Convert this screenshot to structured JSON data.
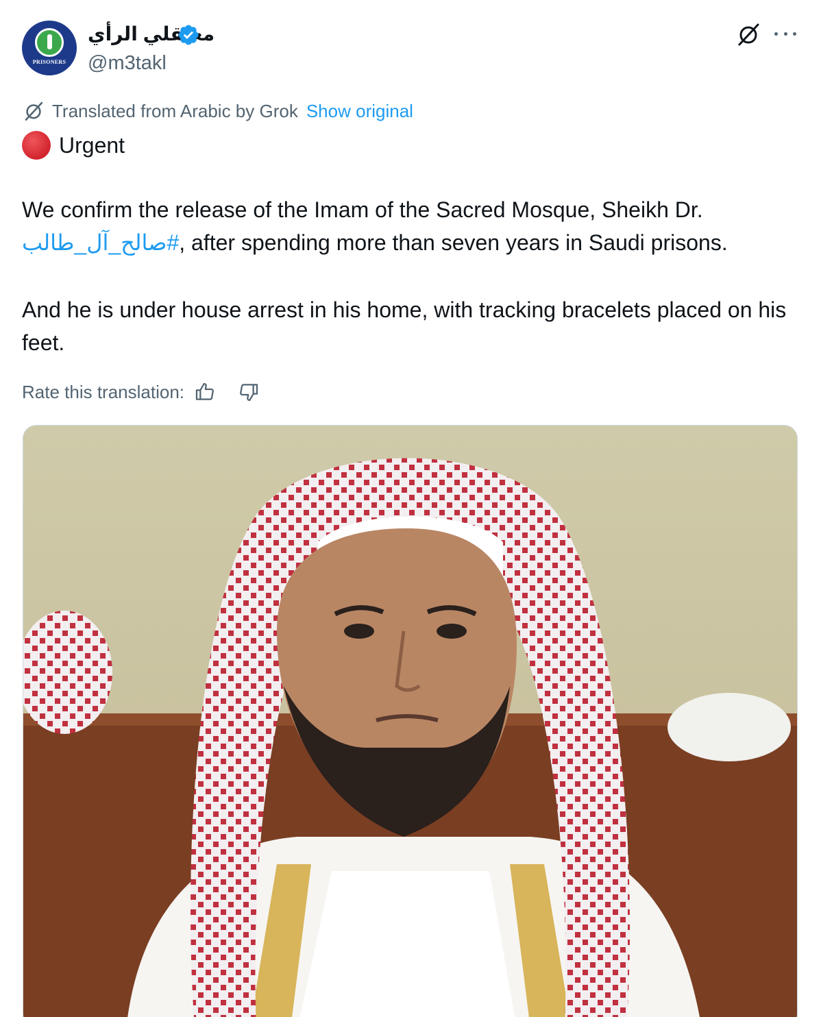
{
  "account": {
    "display_name": "معتقلي الرأي",
    "handle": "@m3takl",
    "avatar_caption": "PRISONERS",
    "verified": true
  },
  "translation": {
    "note": "Translated from Arabic by Grok",
    "show_original": "Show original",
    "rate_label": "Rate this translation:"
  },
  "post": {
    "urgent_label": "Urgent",
    "para1_before": "We confirm the release of the Imam of the Sacred Mosque, Sheikh Dr.",
    "hashtag": "#صالح_آل_طالب",
    "para1_after": ", after spending more than seven years in Saudi prisons.",
    "para2": "And he is under house arrest in his home, with tracking bracelets placed on his feet."
  },
  "media": {
    "icon": "photo-portrait"
  },
  "colors": {
    "link": "#1d9bf0",
    "secondary_text": "#536471",
    "verified_badge": "#1d9bf0",
    "urgent_dot": "#d1242d"
  }
}
